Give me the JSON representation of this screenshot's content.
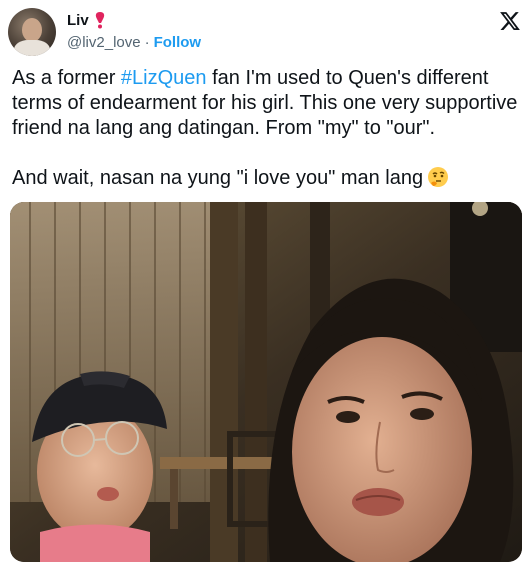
{
  "author": {
    "display_name": "Liv",
    "handle": "@liv2_love",
    "separator": "·",
    "follow_label": "Follow",
    "badge_icon": "red-exclamation-icon"
  },
  "platform": {
    "logo": "x-logo-icon"
  },
  "tweet": {
    "line1_prefix": "As a former ",
    "hashtag": "#LizQuen",
    "line1_suffix": " fan I'm used to Quen's different terms of endearment for his girl. This one very supportive friend na lang ang datingan. From \"my\" to \"our\".",
    "line2": "And wait, nasan na yung \"i love you\" man lang",
    "emoji": "thinking-face-icon"
  },
  "colors": {
    "link": "#1d9bf0",
    "text": "#0f1419",
    "secondary": "#536471",
    "badge": "#e0245e"
  }
}
